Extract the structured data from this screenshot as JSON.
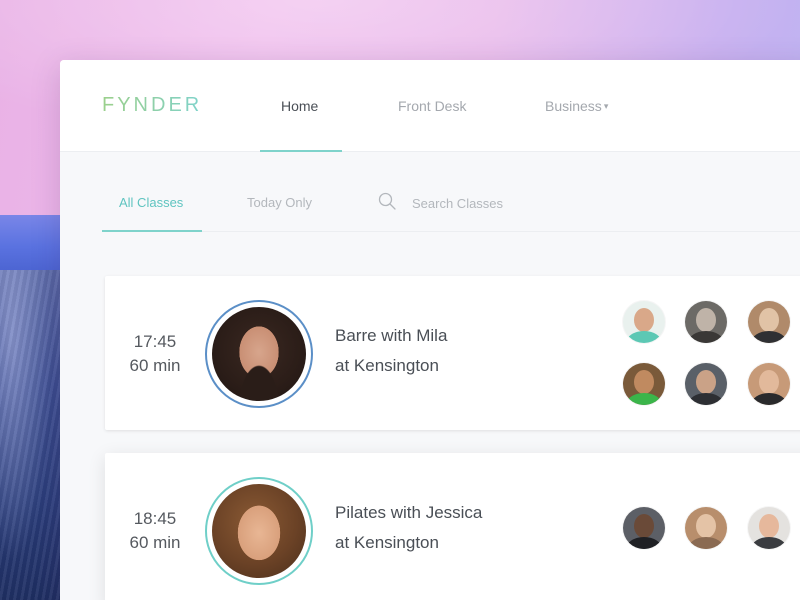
{
  "app": {
    "logo": "FYNDER",
    "nav": [
      {
        "label": "Home",
        "active": true
      },
      {
        "label": "Front Desk",
        "active": false
      },
      {
        "label": "Business",
        "active": false,
        "has_dropdown": true
      }
    ]
  },
  "filters": {
    "tabs": [
      {
        "label": "All Classes",
        "active": true
      },
      {
        "label": "Today Only",
        "active": false
      }
    ],
    "search": {
      "placeholder": "Search Classes",
      "value": ""
    }
  },
  "classes": [
    {
      "time": "17:45",
      "duration": "60 min",
      "title": "Barre with Mila",
      "location": "at Kensington",
      "ring_color": "#5b8fc7",
      "attendee_count": 6
    },
    {
      "time": "18:45",
      "duration": "60 min",
      "title": "Pilates with Jessica",
      "location": "at Kensington",
      "ring_color": "#6fcfc8",
      "attendee_count": 3
    }
  ],
  "colors": {
    "accent": "#7fd3cb",
    "active_filter": "#5fc4c0",
    "text_dark": "#4a4f56",
    "text_muted": "#a4a8ae"
  }
}
